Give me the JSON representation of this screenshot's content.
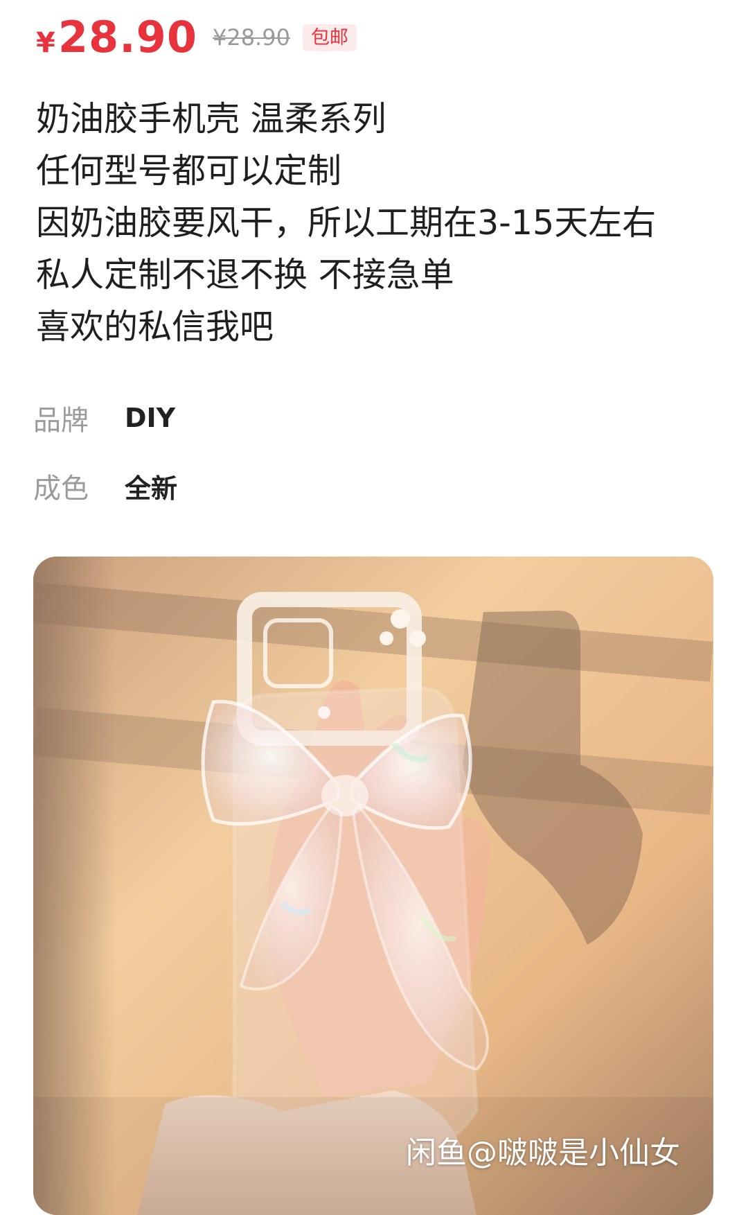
{
  "price": {
    "symbol": "¥",
    "current": "28.90",
    "original": "¥28.90",
    "shipping_badge": "包邮"
  },
  "description": [
    "奶油胶手机壳 温柔系列",
    "任何型号都可以定制",
    "因奶油胶要风干，所以工期在3-15天左右",
    "私人定制不退不换  不接急单",
    "喜欢的私信我吧"
  ],
  "attributes": [
    {
      "label": "品牌",
      "value": "DIY"
    },
    {
      "label": "成色",
      "value": "全新"
    }
  ],
  "product_image": {
    "watermark": "闲鱼@啵啵是小仙女"
  },
  "colors": {
    "price_red": "#e8333d",
    "badge_bg": "#fdeaea",
    "muted_gray": "#9b9b9b"
  }
}
